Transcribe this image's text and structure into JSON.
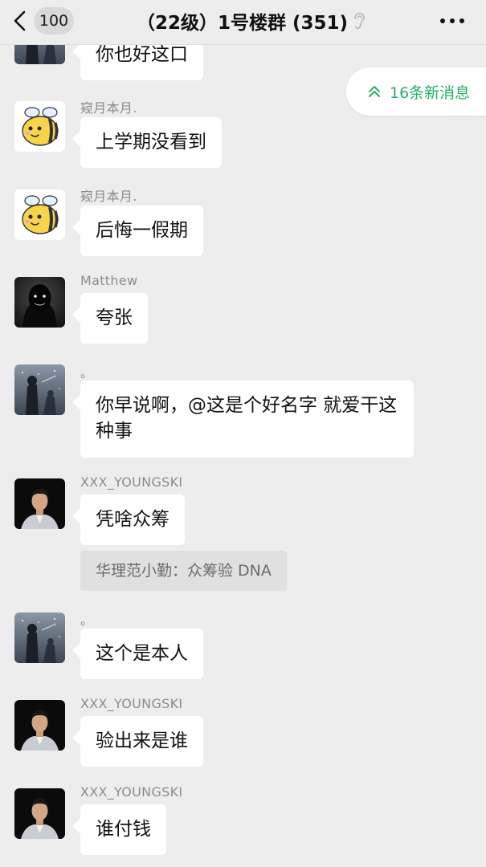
{
  "header": {
    "unread_count": "100",
    "title": "（22级）1号楼群 (351)"
  },
  "new_messages": {
    "label": "16条新消息"
  },
  "messages": [
    {
      "sender": "",
      "text": "你也好这口",
      "avatar": "dark-sword-figure"
    },
    {
      "sender": "窥月本月.",
      "text": "上学期没看到",
      "avatar": "yellow-bee"
    },
    {
      "sender": "窥月本月.",
      "text": "后悔一假期",
      "avatar": "yellow-bee"
    },
    {
      "sender": "Matthew",
      "text": "夸张",
      "avatar": "dark-hooded-figure"
    },
    {
      "sender": "。",
      "text": "你早说啊，@这是个好名字 就爱干这种事",
      "avatar": "dark-sword-figure"
    },
    {
      "sender": "XXX_YOUNGSKI",
      "text": "凭啥众筹",
      "avatar": "man-portrait",
      "quote": "华理范小勤：众筹验 DNA"
    },
    {
      "sender": "。",
      "text": "这个是本人",
      "avatar": "dark-sword-figure"
    },
    {
      "sender": "XXX_YOUNGSKI",
      "text": "验出来是谁",
      "avatar": "man-portrait"
    },
    {
      "sender": "XXX_YOUNGSKI",
      "text": "谁付钱",
      "avatar": "man-portrait"
    }
  ],
  "colors": {
    "background": "#ededed",
    "bubble": "#ffffff",
    "accent_green": "#2aae67",
    "sender_gray": "#8c8c8c"
  }
}
